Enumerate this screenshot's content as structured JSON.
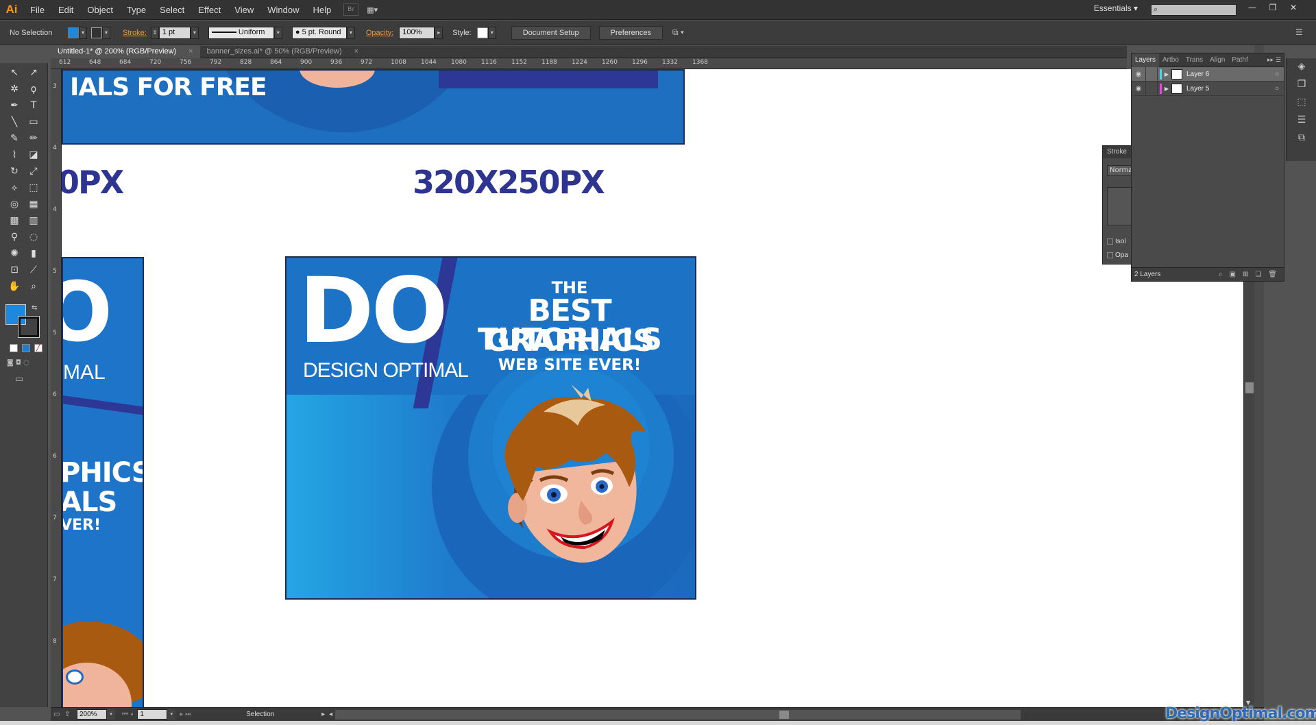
{
  "app": {
    "logo": "Ai"
  },
  "menu": [
    "File",
    "Edit",
    "Object",
    "Type",
    "Select",
    "Effect",
    "View",
    "Window",
    "Help"
  ],
  "menubar_right": {
    "workspace": "Essentials",
    "workspace_arrow": "▾"
  },
  "controlbar": {
    "selection_status": "No Selection",
    "fill_color": "#1f88dc",
    "stroke_label": "Stroke:",
    "stroke_weight": "1 pt",
    "stroke_profile": "Uniform",
    "brush": "5 pt. Round",
    "opacity_label": "Opacity:",
    "opacity_value": "100%",
    "style_label": "Style:",
    "document_setup": "Document Setup",
    "preferences": "Preferences"
  },
  "tabs": [
    {
      "label": "Untitled-1* @ 200% (RGB/Preview)",
      "close": "×"
    },
    {
      "label": "banner_sizes.ai* @ 50% (RGB/Preview)",
      "close": "×"
    }
  ],
  "ruler": {
    "top_ticks": [
      "612",
      "648",
      "684",
      "720",
      "756",
      "792",
      "828",
      "864",
      "900",
      "936",
      "972",
      "1008",
      "1044",
      "1080",
      "1116",
      "1152",
      "1188",
      "1224",
      "1260",
      "1296",
      "1332",
      "1368"
    ],
    "left_ticks": [
      "3",
      "4",
      "4",
      "5",
      "5",
      "6",
      "6",
      "7",
      "7",
      "8"
    ]
  },
  "canvas": {
    "top_banner_text": "IALS FOR FREE",
    "left_size_label": "0PX",
    "main_size_label": "320X250PX",
    "left_banner": {
      "letter": "O",
      "brand": "MAL",
      "line1": "PHICS",
      "line2": "ALS",
      "line3": "VER!"
    },
    "main_banner": {
      "logo_letters": "DO",
      "brand": "DESIGN OPTIMAL",
      "line_the": "THE",
      "line_best": "BEST GRAPHICS",
      "line_tutorials": "TUTORIALS",
      "line_web": "WEB SITE EVER!"
    }
  },
  "layers_panel": {
    "tabs": [
      "Layers",
      "Artbo",
      "Trans",
      "Align",
      "Pathf"
    ],
    "layers": [
      {
        "name": "Layer 6",
        "color": "#4fd5e8",
        "selected": true
      },
      {
        "name": "Layer 5",
        "color": "#e24ae0",
        "selected": false
      }
    ],
    "count": "2 Layers"
  },
  "stroke_panel": {
    "title": "Stroke",
    "mode": "Normal",
    "isolate": "Isol",
    "opacity": "Opa"
  },
  "statusbar": {
    "zoom": "200%",
    "artboard": "1",
    "tool": "Selection"
  },
  "watermark": "DesignOptimal.com"
}
